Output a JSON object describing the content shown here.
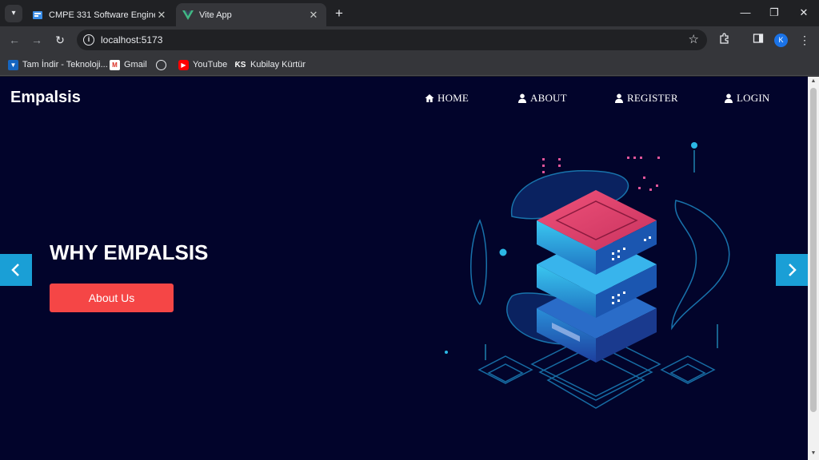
{
  "browser": {
    "tabs": [
      {
        "title": "CMPE 331 Software Engineering",
        "active": false
      },
      {
        "title": "Vite App",
        "active": true
      }
    ],
    "url": "localhost:5173",
    "profile_initial": "K",
    "bookmarks": [
      {
        "label": "Tam İndir - Teknoloji...",
        "icon": "tamindir-icon"
      },
      {
        "label": "Gmail",
        "icon": "gmail-icon"
      },
      {
        "label": "",
        "icon": "globe-icon"
      },
      {
        "label": "YouTube",
        "icon": "youtube-icon"
      },
      {
        "label": "Kubilay Kürtür",
        "icon": "ks-logo-icon"
      }
    ]
  },
  "page": {
    "logo": "Empalsis",
    "nav": [
      {
        "label": "HOME",
        "icon": "home-icon"
      },
      {
        "label": "ABOUT",
        "icon": "user-icon"
      },
      {
        "label": "REGISTER",
        "icon": "user-icon"
      },
      {
        "label": "LOGIN",
        "icon": "user-icon"
      }
    ],
    "hero": {
      "title": "WHY EMPALSIS",
      "button": "About Us"
    }
  },
  "colors": {
    "page_bg": "#02042b",
    "accent_red": "#f54646",
    "arrow_blue": "#1a9fd6",
    "server_pink": "#e8456a",
    "server_cyan": "#2bb8e6"
  }
}
